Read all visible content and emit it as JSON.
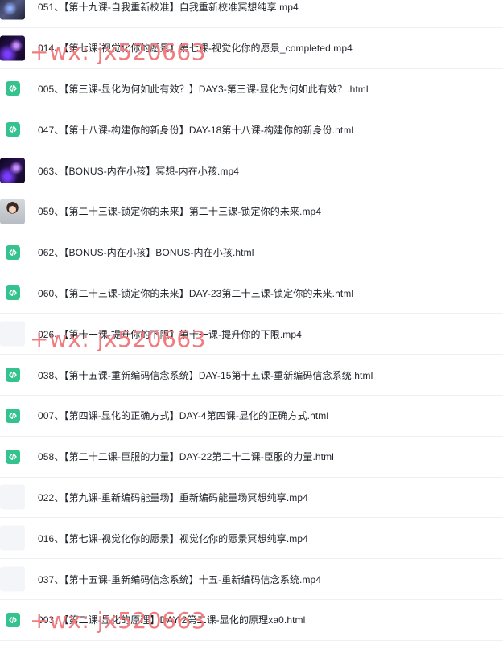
{
  "files": [
    {
      "name": "051、【第十九课-自我重新校准】自我重新校准冥想纯享.mp4",
      "icon": "video-thumbnail-icon",
      "thumb": "video-blue"
    },
    {
      "name": "014、【第七课-视觉化你的愿景】第七课-视觉化你的愿景_completed.mp4",
      "icon": "video-thumbnail-icon",
      "thumb": "video-purple"
    },
    {
      "name": "005、【第三课-显化为何如此有效？】DAY3-第三课-显化为何如此有效？.html",
      "icon": "html-file-icon",
      "thumb": "html"
    },
    {
      "name": "047、【第十八课-构建你的新身份】DAY-18第十八课-构建你的新身份.html",
      "icon": "html-file-icon",
      "thumb": "html"
    },
    {
      "name": "063、【BONUS-内在小孩】冥想-内在小孩.mp4",
      "icon": "video-thumbnail-icon",
      "thumb": "video-purple"
    },
    {
      "name": "059、【第二十三课-锁定你的未来】第二十三课-锁定你的未来.mp4",
      "icon": "video-thumbnail-icon",
      "thumb": "video-person"
    },
    {
      "name": "062、【BONUS-内在小孩】BONUS-内在小孩.html",
      "icon": "html-file-icon",
      "thumb": "html"
    },
    {
      "name": "060、【第二十三课-锁定你的未来】DAY-23第二十三课-锁定你的未来.html",
      "icon": "html-file-icon",
      "thumb": "html"
    },
    {
      "name": "026、【第十一课-提升你的下限】第十一课-提升你的下限.mp4",
      "icon": "video-thumbnail-icon",
      "thumb": "blank"
    },
    {
      "name": "038、【第十五课-重新编码信念系统】DAY-15第十五课-重新编码信念系统.html",
      "icon": "html-file-icon",
      "thumb": "html"
    },
    {
      "name": "007、【第四课-显化的正确方式】DAY-4第四课-显化的正确方式.html",
      "icon": "html-file-icon",
      "thumb": "html"
    },
    {
      "name": "058、【第二十二课-臣服的力量】DAY-22第二十二课-臣服的力量.html",
      "icon": "html-file-icon",
      "thumb": "html"
    },
    {
      "name": "022、【第九课-重新编码能量场】重新编码能量场冥想纯享.mp4",
      "icon": "video-thumbnail-icon",
      "thumb": "blank"
    },
    {
      "name": "016、【第七课-视觉化你的愿景】视觉化你的愿景冥想纯享.mp4",
      "icon": "video-thumbnail-icon",
      "thumb": "blank"
    },
    {
      "name": "037、【第十五课-重新编码信念系统】十五-重新编码信念系统.mp4",
      "icon": "video-thumbnail-icon",
      "thumb": "blank"
    },
    {
      "name": "003、【第二课-显化的原理】DAY-2第二课-显化的原理xa0.html",
      "icon": "html-file-icon",
      "thumb": "html"
    }
  ],
  "watermarks": [
    "+wx: jx520663",
    "+wx: jx520663",
    "+wx: jx520663"
  ],
  "colors": {
    "html_icon": "#34c38f",
    "watermark": "#f07c80",
    "divider": "#eef0f3"
  }
}
